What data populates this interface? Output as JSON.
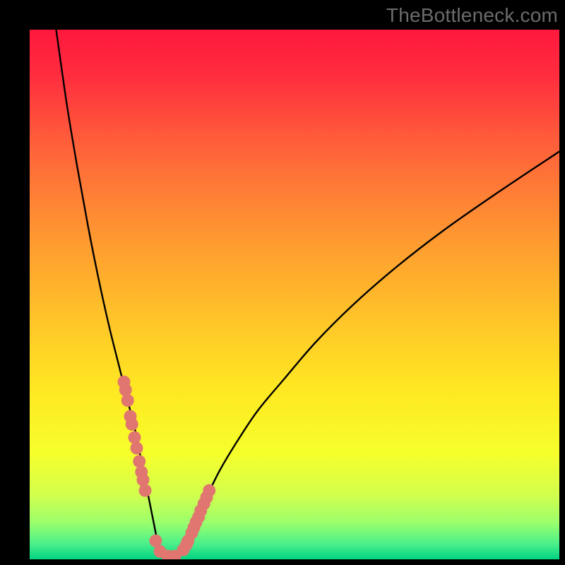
{
  "watermark": "TheBottleneck.com",
  "chart_data": {
    "type": "line",
    "title": "",
    "xlabel": "",
    "ylabel": "",
    "xlim": [
      0,
      100
    ],
    "ylim": [
      0,
      100
    ],
    "curve_left": {
      "name": "left-branch",
      "x": [
        5,
        7,
        9,
        11,
        13,
        15,
        17,
        18.5,
        20,
        21,
        22,
        22.8,
        23.4,
        24,
        24.5,
        25
      ],
      "y": [
        100,
        86,
        74,
        63,
        53,
        44,
        36,
        30,
        24,
        19,
        14,
        10,
        7,
        4,
        2,
        0.5
      ]
    },
    "curve_right": {
      "name": "right-branch",
      "x": [
        28,
        29,
        30,
        31,
        32.5,
        34,
        36,
        39,
        43,
        48,
        54,
        61,
        69,
        78,
        88,
        100
      ],
      "y": [
        0.5,
        2,
        4,
        6.5,
        9.5,
        13,
        17,
        22,
        28,
        34,
        41,
        48,
        55,
        62,
        69,
        77
      ]
    },
    "flat_segment": {
      "name": "valley-floor",
      "x": [
        25,
        28
      ],
      "y": [
        0.5,
        0.5
      ]
    },
    "series": [
      {
        "name": "red-dots",
        "type": "scatter",
        "color": "#e0766f",
        "x": [
          17.8,
          18.1,
          18.5,
          19.0,
          19.3,
          19.8,
          20.2,
          20.7,
          21.1,
          21.4,
          21.8,
          23.8,
          24.6,
          26.1,
          27.4,
          29.0,
          29.6,
          29.9,
          30.6,
          31.0,
          31.4,
          31.9,
          32.3,
          32.9,
          33.4,
          33.9
        ],
        "y": [
          33.5,
          32.0,
          30.0,
          27.0,
          25.5,
          23.0,
          21.0,
          18.5,
          16.5,
          15.0,
          13.0,
          3.5,
          1.5,
          0.6,
          0.6,
          1.8,
          2.8,
          3.5,
          5.0,
          6.0,
          7.0,
          8.0,
          9.2,
          10.5,
          11.7,
          13.0
        ]
      }
    ],
    "gradient_stops": [
      {
        "offset": 0.0,
        "color": "#ff183d"
      },
      {
        "offset": 0.09,
        "color": "#ff2e3e"
      },
      {
        "offset": 0.2,
        "color": "#ff5a3b"
      },
      {
        "offset": 0.32,
        "color": "#ff8235"
      },
      {
        "offset": 0.44,
        "color": "#ffa62e"
      },
      {
        "offset": 0.56,
        "color": "#ffc828"
      },
      {
        "offset": 0.68,
        "color": "#ffe822"
      },
      {
        "offset": 0.8,
        "color": "#f6ff2b"
      },
      {
        "offset": 0.88,
        "color": "#d1ff4e"
      },
      {
        "offset": 0.93,
        "color": "#9cff6c"
      },
      {
        "offset": 0.97,
        "color": "#4cf08a"
      },
      {
        "offset": 1.0,
        "color": "#02d481"
      }
    ]
  }
}
